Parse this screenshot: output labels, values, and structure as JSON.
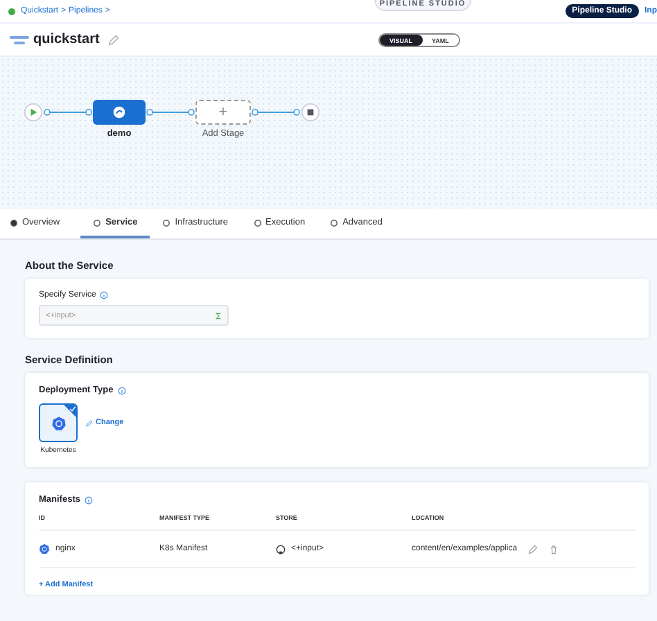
{
  "breadcrumb": {
    "items": [
      "Quickstart",
      "Pipelines"
    ],
    "separator": ">"
  },
  "studio_tab": "PIPELINE STUDIO",
  "top_actions": [
    {
      "label": "Pipeline Studio",
      "selected": true
    },
    {
      "label": "Inp",
      "selected": false
    }
  ],
  "pipeline": {
    "name": "quickstart"
  },
  "view_toggle": [
    {
      "label": "VISUAL",
      "selected": true
    },
    {
      "label": "YAML",
      "selected": false
    }
  ],
  "canvas": {
    "stages": [
      {
        "kind": "stage",
        "label": "demo"
      },
      {
        "kind": "add",
        "label": "Add Stage",
        "symbol": "+"
      }
    ]
  },
  "tabs": [
    {
      "label": "Overview",
      "selected": false
    },
    {
      "label": "Service",
      "selected": true
    },
    {
      "label": "Infrastructure",
      "selected": false
    },
    {
      "label": "Execution",
      "selected": false
    },
    {
      "label": "Advanced",
      "selected": false
    }
  ],
  "about_service": {
    "title": "About the Service",
    "field_label": "Specify Service",
    "value": "<+input>"
  },
  "service_definition": {
    "title": "Service Definition",
    "deployment_label": "Deployment Type",
    "deployment": {
      "label": "Kubernetes",
      "selected": true
    },
    "change_link": "Change"
  },
  "manifests": {
    "title": "Manifests",
    "columns": [
      "ID",
      "MANIFEST TYPE",
      "STORE",
      "LOCATION"
    ],
    "rows": [
      {
        "id": "nginx",
        "type": "K8s Manifest",
        "store": "<+input>",
        "location": "content/en/examples/applica"
      }
    ],
    "add_link": "+ Add Manifest"
  }
}
